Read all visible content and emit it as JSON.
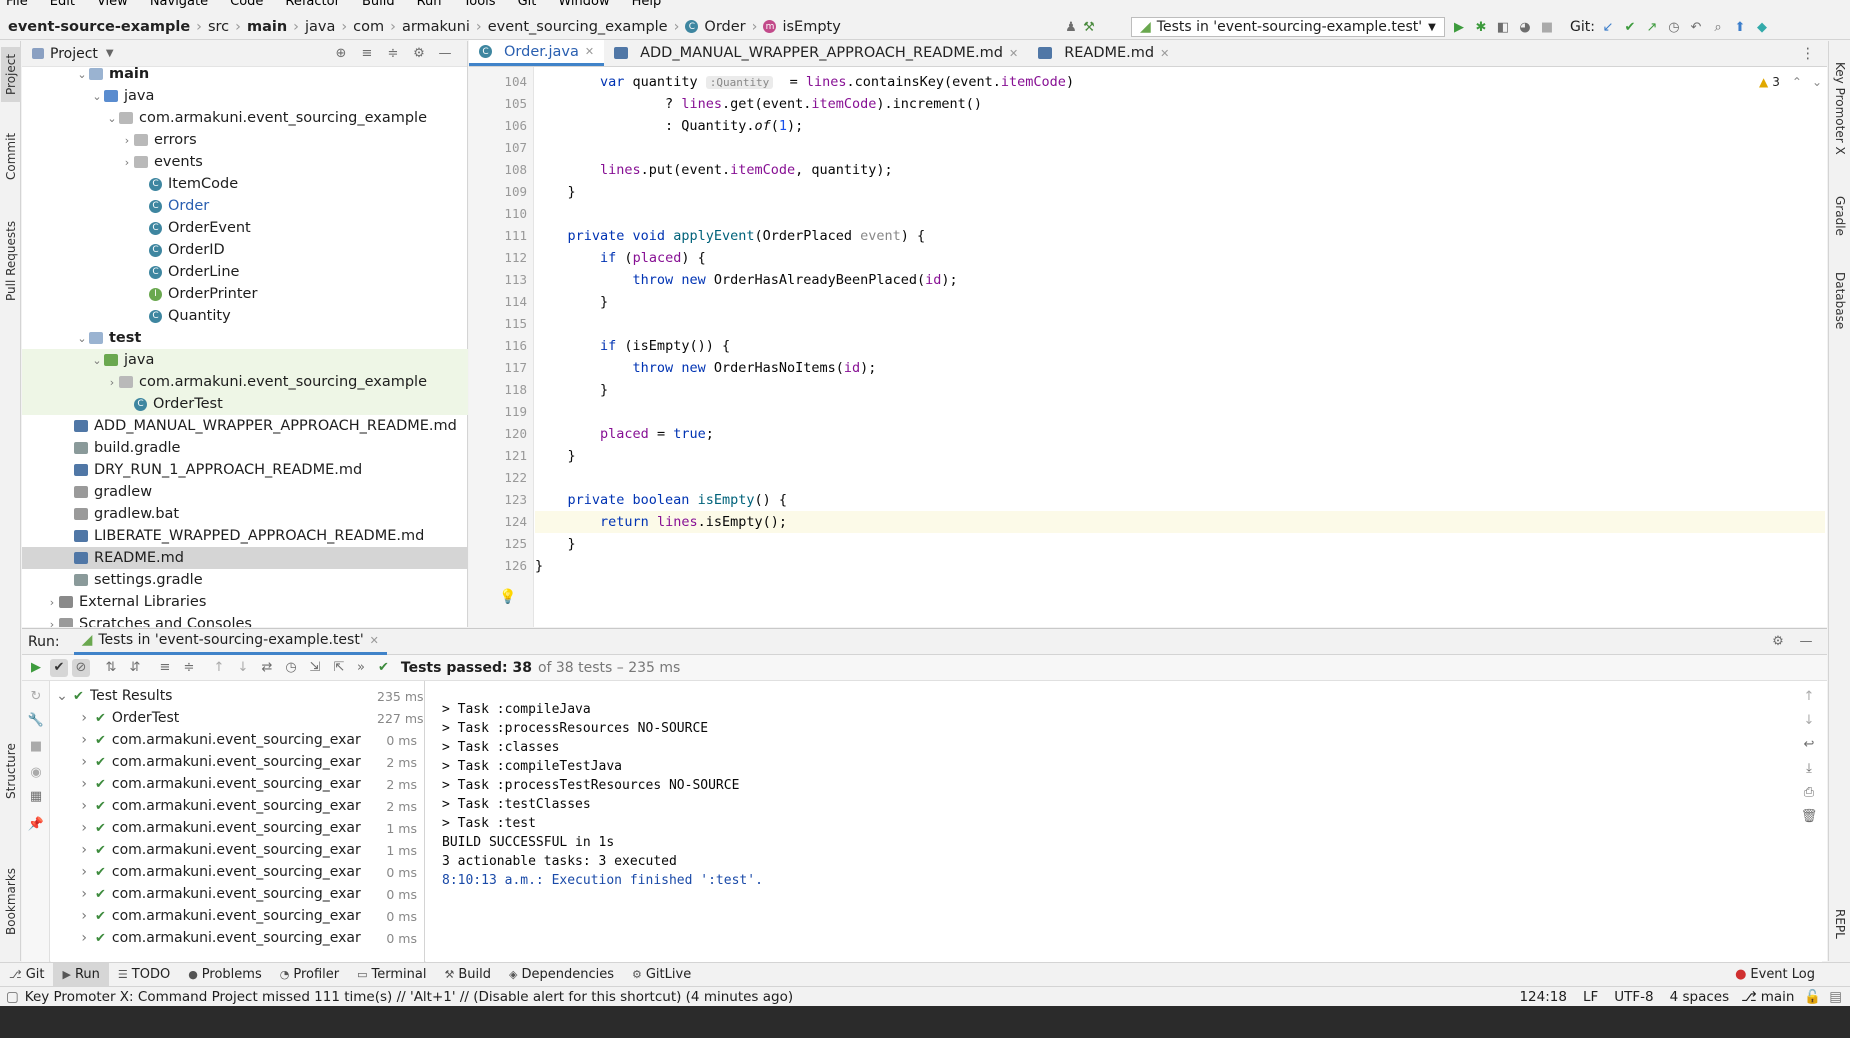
{
  "menu": [
    "File",
    "Edit",
    "View",
    "Navigate",
    "Code",
    "Refactor",
    "Build",
    "Run",
    "Tools",
    "Git",
    "Window",
    "Help"
  ],
  "breadcrumb": [
    "event-source-example",
    "src",
    "main",
    "java",
    "com",
    "armakuni",
    "event_sourcing_example",
    "Order",
    "isEmpty"
  ],
  "run_config": "Tests in 'event-sourcing-example.test'",
  "git_label": "Git:",
  "left_strip": [
    "Project",
    "Commit",
    "Pull Requests",
    "Structure",
    "Bookmarks"
  ],
  "right_strip": [
    "Key Promoter X",
    "Gradle",
    "Database",
    "REPL"
  ],
  "project": {
    "title": "Project",
    "tree": [
      {
        "label": "main",
        "indent": 3,
        "arrow": "v",
        "kind": "folder",
        "bold": true
      },
      {
        "label": "java",
        "indent": 4,
        "arrow": "v",
        "kind": "srcfolder"
      },
      {
        "label": "com.armakuni.event_sourcing_example",
        "indent": 5,
        "arrow": "v",
        "kind": "package"
      },
      {
        "label": "errors",
        "indent": 6,
        "arrow": ">",
        "kind": "package"
      },
      {
        "label": "events",
        "indent": 6,
        "arrow": ">",
        "kind": "package"
      },
      {
        "label": "ItemCode",
        "indent": 7,
        "arrow": "",
        "kind": "class"
      },
      {
        "label": "Order",
        "indent": 7,
        "arrow": "",
        "kind": "class",
        "blue": true
      },
      {
        "label": "OrderEvent",
        "indent": 7,
        "arrow": "",
        "kind": "class"
      },
      {
        "label": "OrderID",
        "indent": 7,
        "arrow": "",
        "kind": "class"
      },
      {
        "label": "OrderLine",
        "indent": 7,
        "arrow": "",
        "kind": "class"
      },
      {
        "label": "OrderPrinter",
        "indent": 7,
        "arrow": "",
        "kind": "interface"
      },
      {
        "label": "Quantity",
        "indent": 7,
        "arrow": "",
        "kind": "class"
      },
      {
        "label": "test",
        "indent": 3,
        "arrow": "v",
        "kind": "folder",
        "bold": true
      },
      {
        "label": "java",
        "indent": 4,
        "arrow": "v",
        "kind": "testfolder",
        "green": true
      },
      {
        "label": "com.armakuni.event_sourcing_example",
        "indent": 5,
        "arrow": ">",
        "kind": "package",
        "green": true
      },
      {
        "label": "OrderTest",
        "indent": 6,
        "arrow": "",
        "kind": "class",
        "green": true
      },
      {
        "label": "ADD_MANUAL_WRAPPER_APPROACH_README.md",
        "indent": 2,
        "arrow": "",
        "kind": "md"
      },
      {
        "label": "build.gradle",
        "indent": 2,
        "arrow": "",
        "kind": "gradle"
      },
      {
        "label": "DRY_RUN_1_APPROACH_README.md",
        "indent": 2,
        "arrow": "",
        "kind": "md"
      },
      {
        "label": "gradlew",
        "indent": 2,
        "arrow": "",
        "kind": "file"
      },
      {
        "label": "gradlew.bat",
        "indent": 2,
        "arrow": "",
        "kind": "file"
      },
      {
        "label": "LIBERATE_WRAPPED_APPROACH_README.md",
        "indent": 2,
        "arrow": "",
        "kind": "md"
      },
      {
        "label": "README.md",
        "indent": 2,
        "arrow": "",
        "kind": "md",
        "selected": true
      },
      {
        "label": "settings.gradle",
        "indent": 2,
        "arrow": "",
        "kind": "gradle"
      },
      {
        "label": "External Libraries",
        "indent": 1,
        "arrow": ">",
        "kind": "lib"
      },
      {
        "label": "Scratches and Consoles",
        "indent": 1,
        "arrow": ">",
        "kind": "scratch"
      }
    ]
  },
  "tabs": [
    {
      "label": "Order.java",
      "active": true
    },
    {
      "label": "ADD_MANUAL_WRAPPER_APPROACH_README.md",
      "active": false
    },
    {
      "label": "README.md",
      "active": false
    }
  ],
  "warnings": "3",
  "code": [
    {
      "n": "104",
      "html": "        <span class='kw'>var</span> quantity <span class='hint'>:Quantity</span>  = <span class='fld'>lines</span>.containsKey(event.<span class='fld'>itemCode</span>)"
    },
    {
      "n": "105",
      "html": "                ? <span class='fld'>lines</span>.get(event.<span class='fld'>itemCode</span>).increment()"
    },
    {
      "n": "106",
      "html": "                : Quantity.<i>of</i>(<span class='num'>1</span>);"
    },
    {
      "n": "107",
      "html": ""
    },
    {
      "n": "108",
      "html": "        <span class='fld'>lines</span>.put(event.<span class='fld'>itemCode</span>, quantity);"
    },
    {
      "n": "109",
      "html": "    }"
    },
    {
      "n": "110",
      "html": ""
    },
    {
      "n": "111",
      "html": "    <span class='kw'>private void</span> <span class='fn'>applyEvent</span>(OrderPlaced <span style='color:#888'>event</span>) {"
    },
    {
      "n": "112",
      "html": "        <span class='kw'>if</span> (<span class='fld'>placed</span>) {"
    },
    {
      "n": "113",
      "html": "            <span class='kw'>throw new</span> OrderHasAlreadyBeenPlaced(<span class='fld'>id</span>);"
    },
    {
      "n": "114",
      "html": "        }"
    },
    {
      "n": "115",
      "html": ""
    },
    {
      "n": "116",
      "html": "        <span class='kw'>if</span> (isEmpty()) {"
    },
    {
      "n": "117",
      "html": "            <span class='kw'>throw new</span> OrderHasNoItems(<span class='fld'>id</span>);"
    },
    {
      "n": "118",
      "html": "        }"
    },
    {
      "n": "119",
      "html": ""
    },
    {
      "n": "120",
      "html": "        <span class='fld'>placed</span> = <span class='kw'>true</span>;"
    },
    {
      "n": "121",
      "html": "    }"
    },
    {
      "n": "122",
      "html": ""
    },
    {
      "n": "123",
      "html": "    <span class='kw'>private boolean</span> <span class='fn'>isEmpty</span>() {"
    },
    {
      "n": "124",
      "html": "        <span class='kw'>return</span> <span class='fld'>lines</span>.isEmpty();",
      "current": true
    },
    {
      "n": "125",
      "html": "    }"
    },
    {
      "n": "126",
      "html": "}"
    }
  ],
  "run": {
    "label": "Run:",
    "tab": "Tests in 'event-sourcing-example.test'",
    "status_bold": "Tests passed: 38",
    "status_rest": "of 38 tests – 235 ms",
    "results_title": "Test Results",
    "results_time": "235 ms",
    "results": [
      {
        "label": "OrderTest",
        "ms": "227 ms"
      },
      {
        "label": "com.armakuni.event_sourcing_exar",
        "ms": "0 ms"
      },
      {
        "label": "com.armakuni.event_sourcing_exar",
        "ms": "2 ms"
      },
      {
        "label": "com.armakuni.event_sourcing_exar",
        "ms": "2 ms"
      },
      {
        "label": "com.armakuni.event_sourcing_exar",
        "ms": "2 ms"
      },
      {
        "label": "com.armakuni.event_sourcing_exar",
        "ms": "1 ms"
      },
      {
        "label": "com.armakuni.event_sourcing_exar",
        "ms": "1 ms"
      },
      {
        "label": "com.armakuni.event_sourcing_exar",
        "ms": "0 ms"
      },
      {
        "label": "com.armakuni.event_sourcing_exar",
        "ms": "0 ms"
      },
      {
        "label": "com.armakuni.event_sourcing_exar",
        "ms": "0 ms"
      },
      {
        "label": "com.armakuni.event_sourcing_exar",
        "ms": "0 ms"
      }
    ],
    "console": [
      {
        "text": "> Task :compileJava"
      },
      {
        "text": "> Task :processResources NO-SOURCE"
      },
      {
        "text": "> Task :classes"
      },
      {
        "text": "> Task :compileTestJava"
      },
      {
        "text": "> Task :processTestResources NO-SOURCE"
      },
      {
        "text": "> Task :testClasses"
      },
      {
        "text": "> Task :test"
      },
      {
        "text": "BUILD SUCCESSFUL in 1s"
      },
      {
        "text": "3 actionable tasks: 3 executed"
      },
      {
        "text": "8:10:13 a.m.: Execution finished ':test'.",
        "blue": true
      }
    ]
  },
  "toolwindows": [
    {
      "icon": "⎇",
      "label": "Git"
    },
    {
      "icon": "▶",
      "label": "Run",
      "active": true
    },
    {
      "icon": "☰",
      "label": "TODO"
    },
    {
      "icon": "●",
      "label": "Problems"
    },
    {
      "icon": "◔",
      "label": "Profiler"
    },
    {
      "icon": "▭",
      "label": "Terminal"
    },
    {
      "icon": "⚒",
      "label": "Build"
    },
    {
      "icon": "◈",
      "label": "Dependencies"
    },
    {
      "icon": "⚙",
      "label": "GitLive"
    }
  ],
  "event_log": "Event Log",
  "status": {
    "message": "Key Promoter X: Command Project missed 111 time(s) // 'Alt+1' // (Disable alert for this shortcut) (4 minutes ago)",
    "position": "124:18",
    "line_sep": "LF",
    "encoding": "UTF-8",
    "indent": "4 spaces",
    "branch": "main"
  }
}
